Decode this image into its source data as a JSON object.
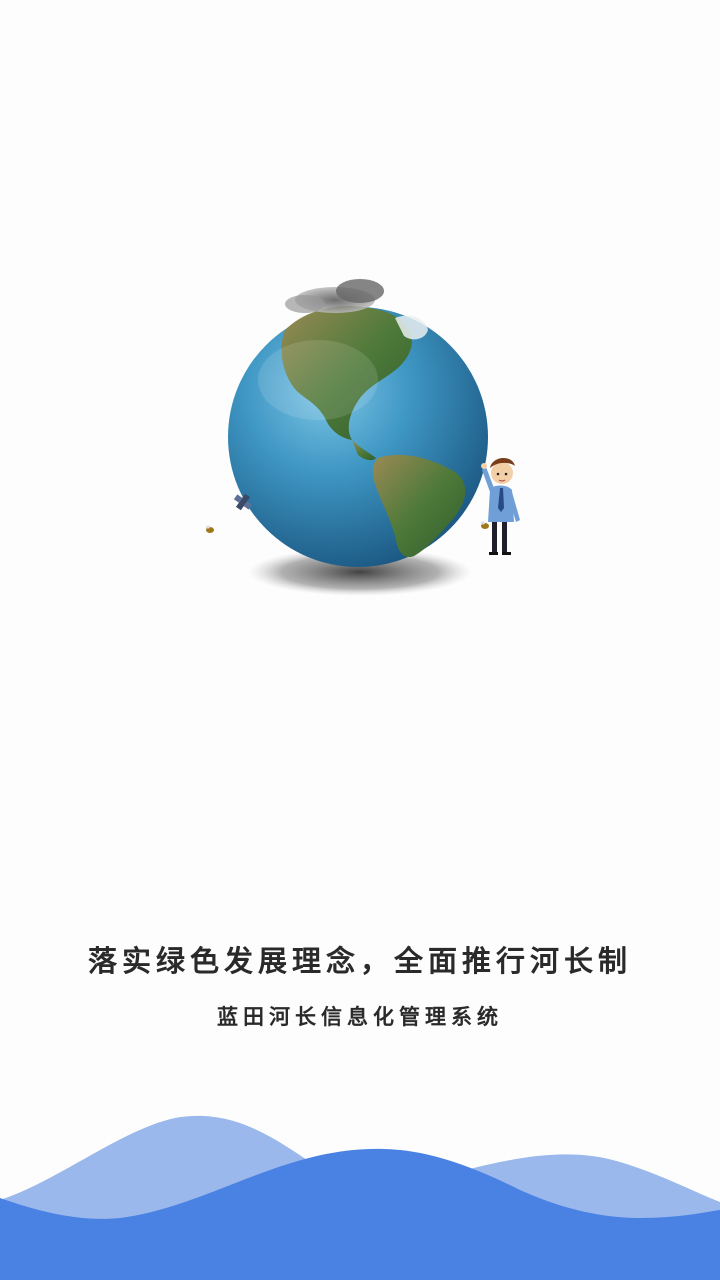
{
  "splash": {
    "slogan": "落实绿色发展理念，全面推行河长制",
    "app_name": "蓝田河长信息化管理系统"
  },
  "illustration": {
    "icons": [
      "earth-globe-icon",
      "cloud-icon",
      "satellite-icon",
      "cartoon-man-icon",
      "bee-icon"
    ]
  },
  "colors": {
    "background": "#fdfdfd",
    "text": "#2a2a2a",
    "wave_light": "#9ab8ec",
    "wave_dark": "#4a82e4"
  }
}
